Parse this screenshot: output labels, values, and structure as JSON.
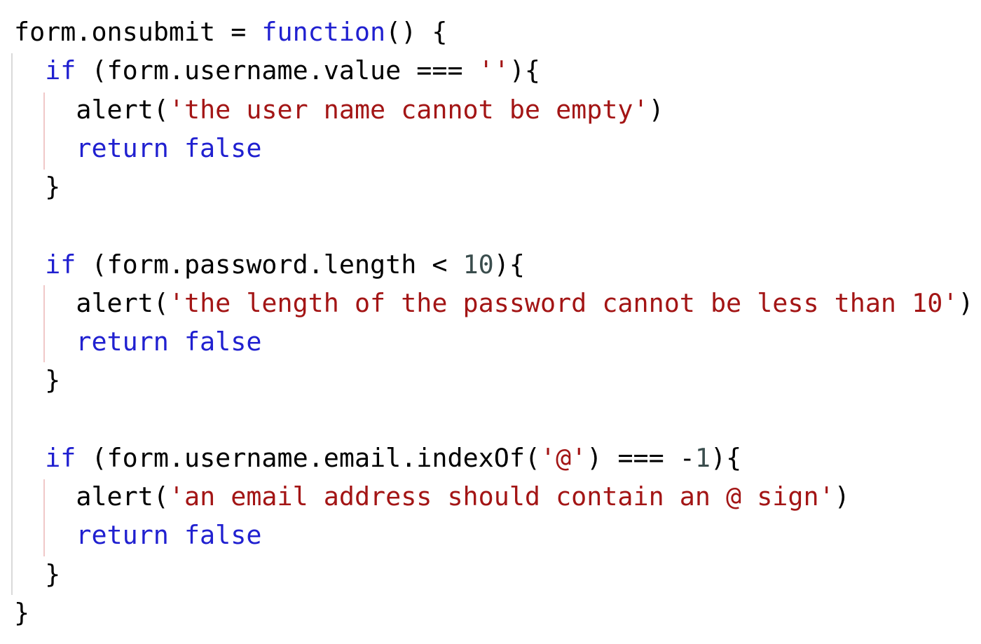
{
  "code_lines": [
    {
      "tokens": [
        {
          "kind": "plain",
          "text": "form.onsubmit = "
        },
        {
          "kind": "kw",
          "text": "function"
        },
        {
          "kind": "plain",
          "text": "() {"
        }
      ]
    },
    {
      "tokens": [
        {
          "kind": "plain",
          "text": "  "
        },
        {
          "kind": "kw",
          "text": "if"
        },
        {
          "kind": "plain",
          "text": " (form.username.value === "
        },
        {
          "kind": "str",
          "text": "''"
        },
        {
          "kind": "plain",
          "text": "){"
        }
      ]
    },
    {
      "tokens": [
        {
          "kind": "plain",
          "text": "    alert("
        },
        {
          "kind": "str",
          "text": "'the user name cannot be empty'"
        },
        {
          "kind": "plain",
          "text": ")"
        }
      ]
    },
    {
      "tokens": [
        {
          "kind": "plain",
          "text": "    "
        },
        {
          "kind": "kw",
          "text": "return false"
        }
      ]
    },
    {
      "tokens": [
        {
          "kind": "plain",
          "text": "  }"
        }
      ]
    },
    {
      "tokens": []
    },
    {
      "tokens": [
        {
          "kind": "plain",
          "text": "  "
        },
        {
          "kind": "kw",
          "text": "if"
        },
        {
          "kind": "plain",
          "text": " (form.password.length < "
        },
        {
          "kind": "num",
          "text": "10"
        },
        {
          "kind": "plain",
          "text": "){"
        }
      ]
    },
    {
      "tokens": [
        {
          "kind": "plain",
          "text": "    alert("
        },
        {
          "kind": "str",
          "text": "'the length of the password cannot be less than 10'"
        },
        {
          "kind": "plain",
          "text": ")"
        }
      ]
    },
    {
      "tokens": [
        {
          "kind": "plain",
          "text": "    "
        },
        {
          "kind": "kw",
          "text": "return false"
        }
      ]
    },
    {
      "tokens": [
        {
          "kind": "plain",
          "text": "  }"
        }
      ]
    },
    {
      "tokens": []
    },
    {
      "tokens": [
        {
          "kind": "plain",
          "text": "  "
        },
        {
          "kind": "kw",
          "text": "if"
        },
        {
          "kind": "plain",
          "text": " (form.username.email.indexOf("
        },
        {
          "kind": "str",
          "text": "'@'"
        },
        {
          "kind": "plain",
          "text": ") === -"
        },
        {
          "kind": "num",
          "text": "1"
        },
        {
          "kind": "plain",
          "text": "){"
        }
      ]
    },
    {
      "tokens": [
        {
          "kind": "plain",
          "text": "    alert("
        },
        {
          "kind": "str",
          "text": "'an email address should contain an @ sign'"
        },
        {
          "kind": "plain",
          "text": ")"
        }
      ]
    },
    {
      "tokens": [
        {
          "kind": "plain",
          "text": "    "
        },
        {
          "kind": "kw",
          "text": "return false"
        }
      ]
    },
    {
      "tokens": [
        {
          "kind": "plain",
          "text": "  }"
        }
      ]
    },
    {
      "tokens": [
        {
          "kind": "plain",
          "text": "}"
        }
      ]
    }
  ],
  "colors": {
    "background": "#ffffff",
    "plain": "#000000",
    "keyword": "#2020d0",
    "string": "#a31515",
    "number": "#3a4d4d",
    "outer_guide": "#d9d9d9",
    "inner_guide": "#f0c8c8"
  }
}
